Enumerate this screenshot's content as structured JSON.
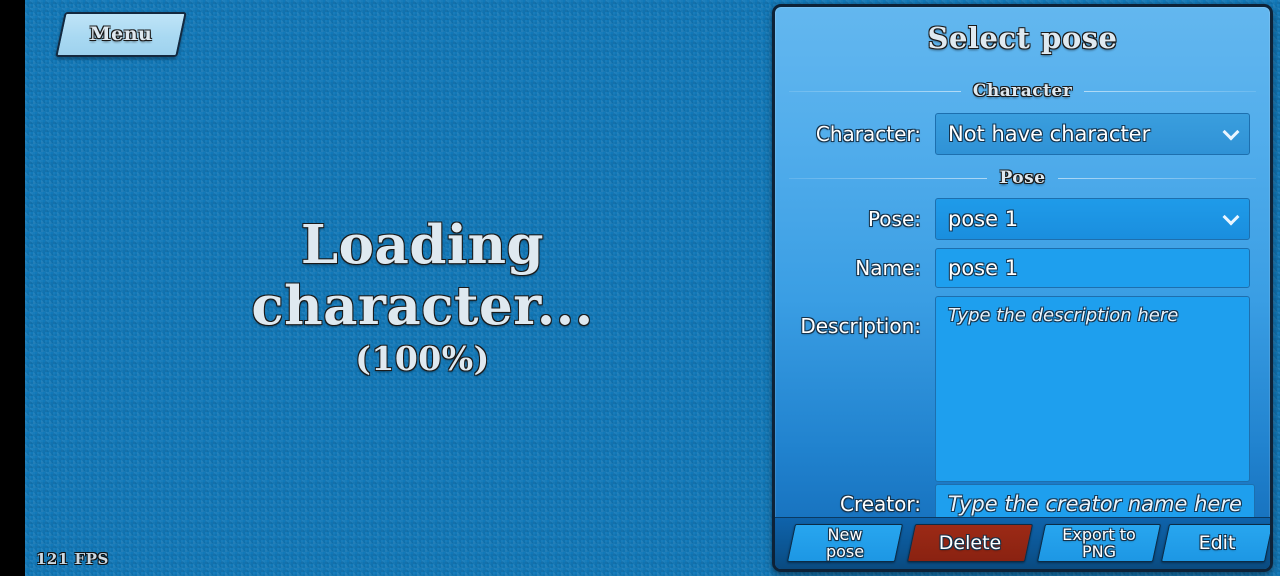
{
  "game": {
    "menu_button_label": "Menu",
    "loading_line1": "Loading",
    "loading_line2": "character...",
    "loading_percent": "(100%)",
    "fps": "121 FPS",
    "background_color": "#1178b8",
    "letterbox_color": "#000000"
  },
  "panel": {
    "title": "Select pose",
    "accent_color": "#1e9fee",
    "danger_color": "#9c2a16",
    "border_color": "#0d2237",
    "sections": {
      "character": {
        "heading": "Character",
        "field_label": "Character:",
        "selected": "Not have character",
        "caret": "chevron-down-icon"
      },
      "pose": {
        "heading": "Pose",
        "pose_label": "Pose:",
        "pose_selected": "pose 1",
        "name_label": "Name:",
        "name_value": "pose 1",
        "description_label": "Description:",
        "description_placeholder": "Type the description here",
        "creator_label": "Creator:",
        "creator_placeholder": "Type the creator name here"
      }
    },
    "toolbar": {
      "new_pose": "New\npose",
      "delete": "Delete",
      "export_png": "Export to\nPNG",
      "edit": "Edit"
    }
  }
}
